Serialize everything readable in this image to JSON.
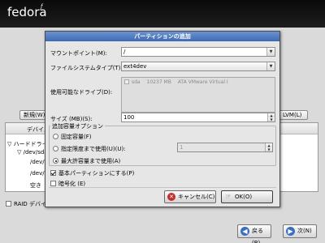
{
  "header": {
    "logo_text": "fedora",
    "logo_mark": "ƒ"
  },
  "background": {
    "new_button": "新規(W)",
    "lvm_button": "LVM(L)",
    "device_column": "デバイス",
    "tree_rows": [
      "ハードドライ",
      "/dev/sda",
      "/dev/s",
      "/dev/s",
      "空き"
    ],
    "raid_label": "RAID デバイ",
    "back_button": "戻る(B)",
    "next_button": "次(N)"
  },
  "dialog": {
    "title": "パーティションの追加",
    "mount_point_label": "マウントポイント(M):",
    "mount_point_value": "/",
    "fs_type_label": "ファイルシステムタイプ(T):",
    "fs_type_value": "ext4dev",
    "drives_label": "使用可能なドライブ(D):",
    "drive": {
      "name": "sda",
      "size": "10237 MB",
      "model": "ATA VMware Virtual I"
    },
    "size_label": "サイズ (MB)(S):",
    "size_value": "100",
    "options_title": "追加容量オプション",
    "opt_fixed": "固定容量(F)",
    "opt_upto": "指定限度まで使用(U)(U):",
    "opt_upto_value": "1",
    "opt_max": "最大許容量まで使用(A)",
    "primary_label": "基本パーティションにする(P)",
    "encrypt_label": "暗号化 (E)",
    "cancel_button": "キャンセル(C)",
    "ok_button": "OK(O)"
  },
  "colors": {
    "title_bar": "#3c6ab4",
    "topbar": "#111111"
  }
}
